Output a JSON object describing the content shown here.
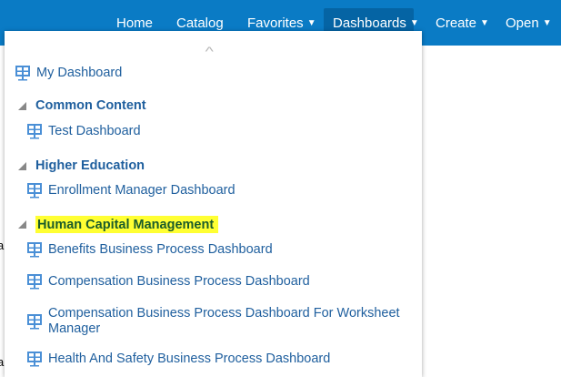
{
  "nav": {
    "items": [
      "Home",
      "Catalog",
      "Favorites",
      "Dashboards",
      "Create",
      "Open"
    ]
  },
  "background": {
    "fragments": [
      "a",
      "a"
    ]
  },
  "menu": {
    "my_dashboard": "My Dashboard",
    "groups": [
      {
        "title": "Common Content",
        "items": [
          "Test Dashboard"
        ]
      },
      {
        "title": "Higher Education",
        "items": [
          "Enrollment Manager Dashboard"
        ]
      },
      {
        "title": "Human Capital Management",
        "highlighted": true,
        "items": [
          "Benefits Business Process Dashboard",
          "Compensation Business Process Dashboard",
          "Compensation Business Process Dashboard For Worksheet Manager",
          "Health And Safety Business Process Dashboard"
        ]
      }
    ]
  },
  "colors": {
    "topbar": "#0a7bc5",
    "active_tab": "#0564a4",
    "link": "#1f5f9e",
    "highlight": "#ffff33"
  }
}
